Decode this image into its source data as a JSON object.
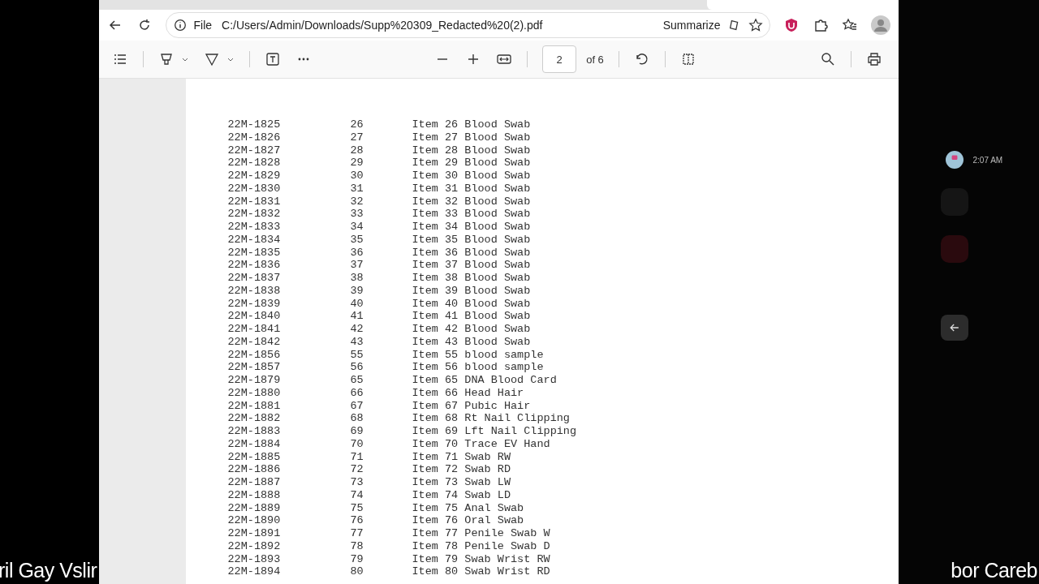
{
  "browser": {
    "address": {
      "scheme": "File",
      "url": "C:/Users/Admin/Downloads/Supp%20309_Redacted%20(2).pdf"
    },
    "summarize": "Summarize"
  },
  "pdf_toolbar": {
    "page": "2",
    "page_count": "of 6"
  },
  "document": {
    "rows": [
      [
        "22M-1825",
        "26",
        "Item 26 Blood Swab"
      ],
      [
        "22M-1826",
        "27",
        "Item 27 Blood Swab"
      ],
      [
        "22M-1827",
        "28",
        "Item 28 Blood Swab"
      ],
      [
        "22M-1828",
        "29",
        "Item 29 Blood Swab"
      ],
      [
        "22M-1829",
        "30",
        "Item 30 Blood Swab"
      ],
      [
        "22M-1830",
        "31",
        "Item 31 Blood Swab"
      ],
      [
        "22M-1831",
        "32",
        "Item 32 Blood Swab"
      ],
      [
        "22M-1832",
        "33",
        "Item 33 Blood Swab"
      ],
      [
        "22M-1833",
        "34",
        "Item 34 Blood Swab"
      ],
      [
        "22M-1834",
        "35",
        "Item 35 Blood Swab"
      ],
      [
        "22M-1835",
        "36",
        "Item 36 Blood Swab"
      ],
      [
        "22M-1836",
        "37",
        "Item 37 Blood Swab"
      ],
      [
        "22M-1837",
        "38",
        "Item 38 Blood Swab"
      ],
      [
        "22M-1838",
        "39",
        "Item 39 Blood Swab"
      ],
      [
        "22M-1839",
        "40",
        "Item 40 Blood Swab"
      ],
      [
        "22M-1840",
        "41",
        "Item 41 Blood Swab"
      ],
      [
        "22M-1841",
        "42",
        "Item 42 Blood Swab"
      ],
      [
        "22M-1842",
        "43",
        "Item 43 Blood Swab"
      ],
      [
        "22M-1856",
        "55",
        "Item 55 blood sample"
      ],
      [
        "22M-1857",
        "56",
        "Item 56 blood sample"
      ],
      [
        "22M-1879",
        "65",
        "Item 65 DNA Blood Card"
      ],
      [
        "22M-1880",
        "66",
        "Item 66 Head Hair"
      ],
      [
        "22M-1881",
        "67",
        "Item 67 Pubic Hair"
      ],
      [
        "22M-1882",
        "68",
        "Item 68 Rt Nail Clipping"
      ],
      [
        "22M-1883",
        "69",
        "Item 69 Lft Nail Clipping"
      ],
      [
        "22M-1884",
        "70",
        "Item 70 Trace EV Hand"
      ],
      [
        "22M-1885",
        "71",
        "Item 71 Swab RW"
      ],
      [
        "22M-1886",
        "72",
        "Item 72 Swab RD"
      ],
      [
        "22M-1887",
        "73",
        "Item 73 Swab LW"
      ],
      [
        "22M-1888",
        "74",
        "Item 74 Swab LD"
      ],
      [
        "22M-1889",
        "75",
        "Item 75 Anal Swab"
      ],
      [
        "22M-1890",
        "76",
        "Item 76 Oral Swab"
      ],
      [
        "22M-1891",
        "77",
        "Item 77 Penile Swab W"
      ],
      [
        "22M-1892",
        "78",
        "Item 78 Penile Swab D"
      ],
      [
        "22M-1893",
        "79",
        "Item 79 Swab Wrist RW"
      ],
      [
        "22M-1894",
        "80",
        "Item 80 Swab Wrist RD"
      ]
    ]
  },
  "side_panel": {
    "time": "2:07 AM"
  },
  "ticker": {
    "left": "ril Gay Vslir",
    "right": "bor  Careb"
  }
}
